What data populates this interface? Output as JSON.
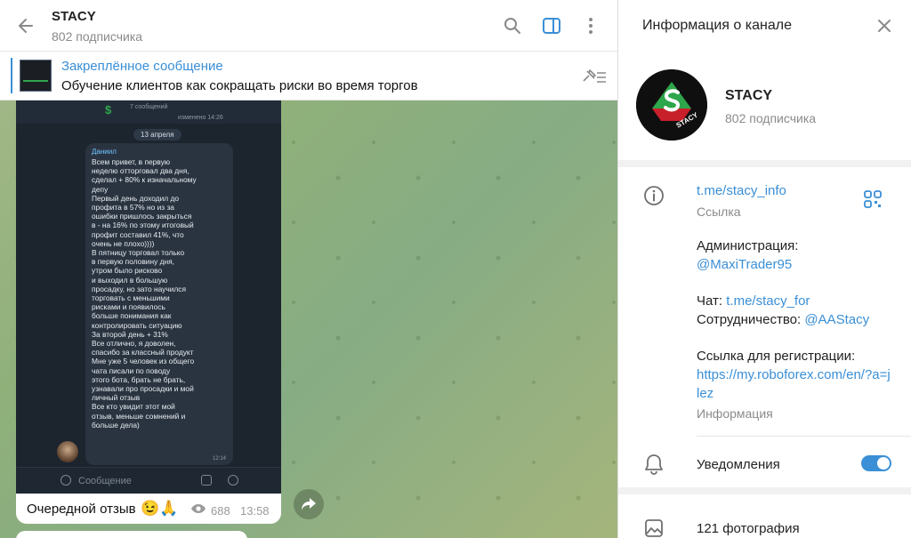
{
  "chat": {
    "channel_name": "STACY",
    "subscribers": "802 подписчика",
    "pinned": {
      "label": "Закреплённое сообщение",
      "text": "Обучение клиентов как сокращать риски во время торгов"
    },
    "screenshot": {
      "header_title": "7 сообщений",
      "header_edited": "изменено 14:26",
      "date": "13 апреля",
      "sender": "Даниил",
      "text": "Всем привет, в первую\nнеделю отторговал два дня,\nсделал + 80% к изначальному\nдепу\nПервый день доходил до\nпрофита в 57% но из за\nошибки пришлось закрыться\nв - на 16% по этому итоговый\nпрофит составил 41%, что\nочень не плохо))))\nВ пятницу торговал только\nв первую половину дня,\nутром было рисково\nи выходил в большую\nпросадку, но зато научился\nторговать с меньшими\nрисками и появилось\nбольше понимания как\nконтролировать ситуацию\nЗа второй день + 31%\nВсе отлично, я доволен,\nспасибо за классный продукт\nМне уже 5 человек из общего\nчата писали по поводу\nэтого бота, брать не брать,\nузнавали про просадки и мой\nличный отзыв\nВсе кто увидит этот мой\nотзыв, меньше сомнений и\nбольше дела)",
      "time": "12:14",
      "input_placeholder": "Сообщение"
    },
    "message": {
      "caption": "Очередной отзыв",
      "emoji": "😉🙏",
      "views": "688",
      "time": "13:58"
    }
  },
  "info": {
    "title": "Информация о канале",
    "name": "STACY",
    "subscribers": "802 подписчика",
    "avatar_text": "STACY",
    "link": "t.me/stacy_info",
    "link_caption": "Ссылка",
    "description": {
      "admin_label": "Администрация:",
      "admin_value": "@MaxiTrader95",
      "chat_label": "Чат:",
      "chat_value": "t.me/stacy_for",
      "coop_label": "Сотрудничество:",
      "coop_value": "@AAStacy",
      "reg_label": "Ссылка для регистрации:",
      "reg_value": "https://my.roboforex.com/en/?a=jlez"
    },
    "description_caption": "Информация",
    "notifications_label": "Уведомления",
    "notifications_on": true,
    "photos_label": "121 фотография"
  },
  "colors": {
    "accent": "#3a8fd6",
    "brand_green": "#2ea64b",
    "brand_red": "#c8202a"
  },
  "icons": [
    "back-arrow-icon",
    "search-icon",
    "sidebar-toggle-icon",
    "more-vertical-icon",
    "unpin-list-icon",
    "eye-icon",
    "share-icon",
    "close-icon",
    "info-icon",
    "qr-code-icon",
    "bell-icon",
    "photo-icon"
  ]
}
